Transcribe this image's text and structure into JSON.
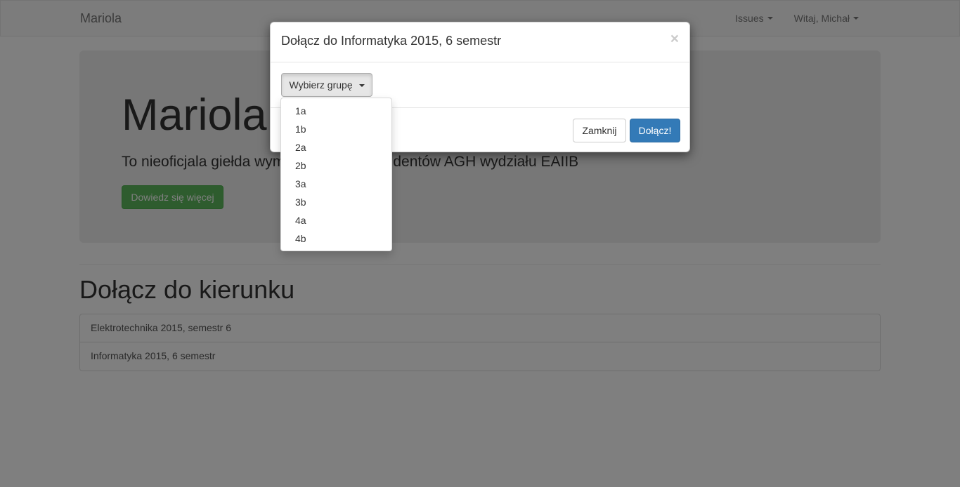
{
  "navbar": {
    "brand": "Mariola",
    "issues_label": "Issues",
    "user_label": "Witaj, Michał"
  },
  "jumbotron": {
    "title": "Mariola",
    "lead": "To nieoficjala giełda wymiany grup dla studentów AGH wydziału EAIIB",
    "button_label": "Dowiedz się więcej"
  },
  "section": {
    "title": "Dołącz do kierunku",
    "items": [
      {
        "label": "Elektrotechnika 2015, semestr 6"
      },
      {
        "label": "Informatyka 2015, 6 semestr"
      }
    ]
  },
  "modal": {
    "title": "Dołącz do Informatyka 2015, 6 semestr",
    "close_symbol": "×",
    "dropdown_label": "Wybierz grupę",
    "dropdown_options": [
      "1a",
      "1b",
      "2a",
      "2b",
      "3a",
      "3b",
      "4a",
      "4b"
    ],
    "close_button_label": "Zamknij",
    "join_button_label": "Dołącz!"
  }
}
